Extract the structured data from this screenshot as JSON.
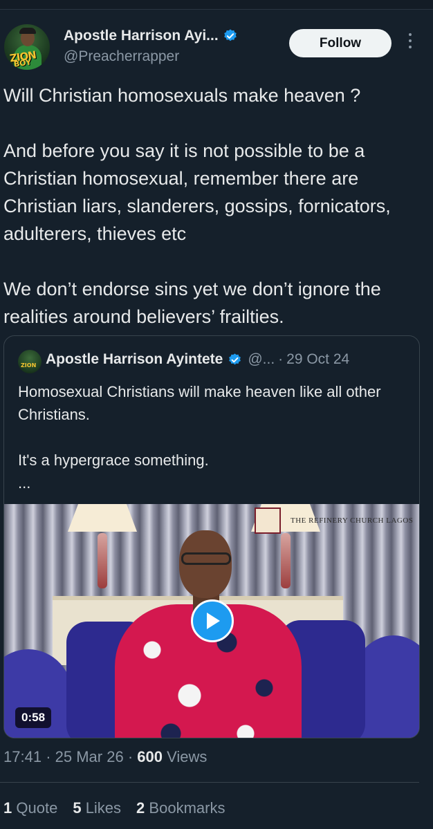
{
  "author": {
    "display_name": "Apostle Harrison Ayi...",
    "handle": "@Preacherrapper",
    "avatar_text_1": "ZION",
    "avatar_text_2": "BOY"
  },
  "follow_label": "Follow",
  "tweet": {
    "paragraphs": [
      "Will Christian homosexuals make heaven ?",
      "And before you say it is not possible to be a Christian homosexual, remember there are Christian liars, slanderers, gossips, fornicators, adulterers, thieves etc",
      "We don’t endorse sins yet we don’t ignore the realities around believers’ frailties."
    ]
  },
  "quote": {
    "display_name": "Apostle Harrison Ayintete",
    "handle": "@...",
    "separator": "·",
    "date": "29 Oct 24",
    "paragraphs": [
      "Homosexual Christians will make heaven like all other Christians.",
      "It's a hypergrace something.",
      "..."
    ],
    "video": {
      "watermark": "THE REFINERY CHURCH LAGOS",
      "duration": "0:58"
    }
  },
  "meta": {
    "time": "17:41",
    "sep1": "·",
    "date": "25 Mar 26",
    "sep2": "·",
    "views_count": "600",
    "views_label": "Views"
  },
  "stats": {
    "quotes_count": "1",
    "quotes_label": "Quote",
    "likes_count": "5",
    "likes_label": "Likes",
    "bookmarks_count": "2",
    "bookmarks_label": "Bookmarks"
  },
  "colors": {
    "background": "#15202b",
    "accent": "#1d9bf0",
    "text_primary": "#e7e9ea",
    "text_secondary": "#8b98a5"
  },
  "icons": [
    "verified-badge-icon",
    "more-options-icon",
    "play-icon"
  ]
}
